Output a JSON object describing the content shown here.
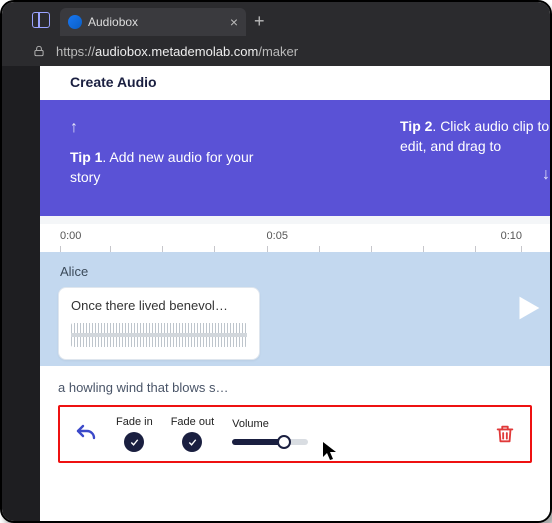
{
  "browser": {
    "tab_title": "Audiobox",
    "url_prefix": "https://",
    "url_host": "audiobox.metademolab.com",
    "url_path": "/maker"
  },
  "header": {
    "title": "Create Audio"
  },
  "tips": {
    "tip1_label": "Tip 1",
    "tip1_text": ". Add new audio for your story",
    "tip2_label": "Tip 2",
    "tip2_text": ". Click audio clip to edit, and drag to"
  },
  "timeline": {
    "marks": [
      "0:00",
      "0:05",
      "0:10"
    ]
  },
  "track": {
    "name": "Alice",
    "clip_text": "Once there lived benevol…"
  },
  "sfx": {
    "label": "a howling wind that blows s…",
    "fade_in_label": "Fade in",
    "fade_out_label": "Fade out",
    "volume_label": "Volume"
  }
}
